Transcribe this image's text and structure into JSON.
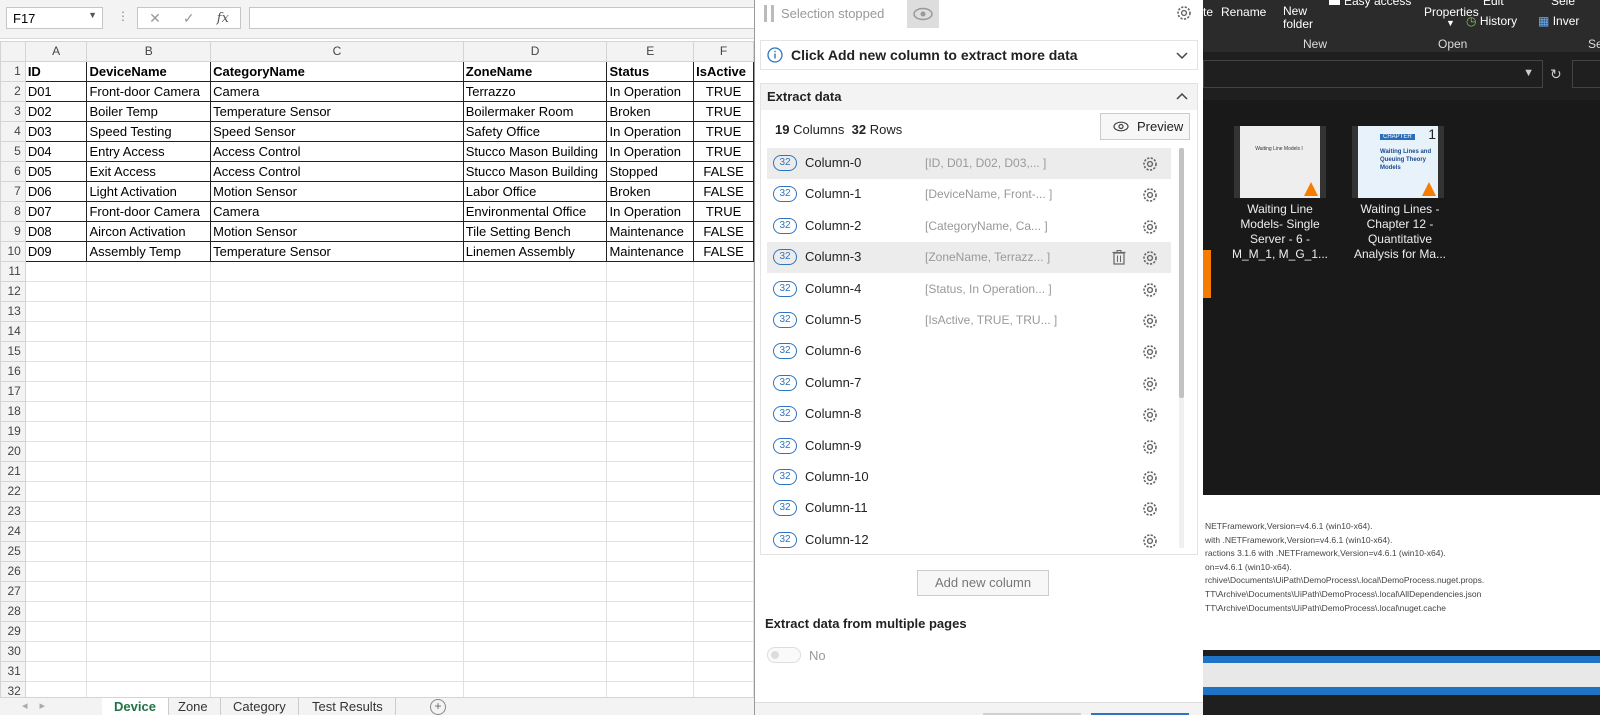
{
  "excel": {
    "name_box": "F17",
    "fx_label": "fx",
    "column_headers": [
      "A",
      "B",
      "C",
      "D",
      "E",
      "F"
    ],
    "header_row": [
      "ID",
      "DeviceName",
      "CategoryName",
      "ZoneName",
      "Status",
      "IsActive"
    ],
    "rows": [
      [
        "D01",
        "Front-door Camera",
        "Camera",
        "Terrazzo",
        "In Operation",
        "TRUE"
      ],
      [
        "D02",
        "Boiler Temp",
        "Temperature Sensor",
        "Boilermaker Room",
        "Broken",
        "TRUE"
      ],
      [
        "D03",
        "Speed Testing",
        "Speed Sensor",
        "Safety Office",
        "In Operation",
        "TRUE"
      ],
      [
        "D04",
        "Entry Access",
        "Access Control",
        "Stucco Mason Building",
        "In Operation",
        "TRUE"
      ],
      [
        "D05",
        "Exit Access",
        "Access Control",
        "Stucco Mason Building",
        "Stopped",
        "FALSE"
      ],
      [
        "D06",
        "Light Activation",
        "Motion Sensor",
        "Labor Office",
        "Broken",
        "FALSE"
      ],
      [
        "D07",
        "Front-door Camera",
        "Camera",
        "Environmental Office",
        "In Operation",
        "TRUE"
      ],
      [
        "D08",
        "Aircon Activation",
        "Motion Sensor",
        "Tile Setting Bench",
        "Maintenance",
        "FALSE"
      ],
      [
        "D09",
        "Assembly Temp",
        "Temperature Sensor",
        "Linemen Assembly",
        "Maintenance",
        "FALSE"
      ]
    ],
    "row_numbers": [
      "1",
      "2",
      "3",
      "4",
      "5",
      "6",
      "7",
      "8",
      "9",
      "10",
      "11",
      "12",
      "13",
      "14",
      "15",
      "16",
      "17",
      "18",
      "19",
      "20",
      "21",
      "22",
      "23",
      "24",
      "25",
      "26",
      "27",
      "28",
      "29",
      "30",
      "31",
      "32"
    ],
    "sheet_tabs": [
      "Device",
      "Zone",
      "Category",
      "Test Results"
    ],
    "active_tab": "Device"
  },
  "extractor": {
    "status": "Selection stopped",
    "info_message": "Click Add new column to extract more data",
    "section_title": "Extract data",
    "columns_count": "19",
    "columns_label": "Columns",
    "rows_count": "32",
    "rows_label": "Rows",
    "preview_label": "Preview",
    "columns": [
      {
        "badge": "32",
        "name": "Column-0",
        "preview": "[ID, D01, D02, D03,...  ]"
      },
      {
        "badge": "32",
        "name": "Column-1",
        "preview": "[DeviceName, Front-...  ]"
      },
      {
        "badge": "32",
        "name": "Column-2",
        "preview": "[CategoryName, Ca...  ]"
      },
      {
        "badge": "32",
        "name": "Column-3",
        "preview": "[ZoneName, Terrazz...  ]"
      },
      {
        "badge": "32",
        "name": "Column-4",
        "preview": "[Status, In Operation...  ]"
      },
      {
        "badge": "32",
        "name": "Column-5",
        "preview": "[IsActive, TRUE, TRU...  ]"
      },
      {
        "badge": "32",
        "name": "Column-6",
        "preview": ""
      },
      {
        "badge": "32",
        "name": "Column-7",
        "preview": ""
      },
      {
        "badge": "32",
        "name": "Column-8",
        "preview": ""
      },
      {
        "badge": "32",
        "name": "Column-9",
        "preview": ""
      },
      {
        "badge": "32",
        "name": "Column-10",
        "preview": ""
      },
      {
        "badge": "32",
        "name": "Column-11",
        "preview": ""
      },
      {
        "badge": "32",
        "name": "Column-12",
        "preview": ""
      }
    ],
    "add_column_label": "Add new column",
    "multi_page_label": "Extract data from multiple pages",
    "multi_page_value": "No"
  },
  "explorer": {
    "ribbon": {
      "paste_label": "te",
      "rename_label": "Rename",
      "new_folder_label": "New folder",
      "easy_access_label": "Easy access",
      "properties_label": "Properties",
      "edit_label": "Edit",
      "history_label": "History",
      "select_label": "Sele",
      "invert_label": "Inver",
      "group_new": "New",
      "group_open": "Open",
      "group_sel": "Se"
    },
    "files": [
      {
        "name": "Waiting Line Models- Single Server - 6 - M_M_1, M_G_1..."
      },
      {
        "name": "Waiting Lines - Chapter 12 - Quantitative Analysis for Ma..."
      }
    ],
    "thumb1_text": "Waiting Line Models I",
    "thumb2_title": "CHAPTER",
    "thumb2_number": "1",
    "thumb2_text": "Waiting Lines and Queuing Theory Models",
    "output_lines": [
      "NETFramework,Version=v4.6.1 (win10-x64).",
      "with .NETFramework,Version=v4.6.1 (win10-x64).",
      "ractions 3.1.6 with .NETFramework,Version=v4.6.1 (win10-x64).",
      "on=v4.6.1 (win10-x64).",
      "rchive\\Documents\\UiPath\\DemoProcess\\.local\\DemoProcess.nuget.props.",
      "TT\\Archive\\Documents\\UiPath\\DemoProcess\\.local\\AllDependencies.json",
      "TT\\Archive\\Documents\\UiPath\\DemoProcess\\.local\\nuget.cache"
    ]
  },
  "colors": {
    "excel_green": "#217346",
    "accent_blue": "#2f74c0",
    "explorer_bg": "#1f1f1f"
  }
}
